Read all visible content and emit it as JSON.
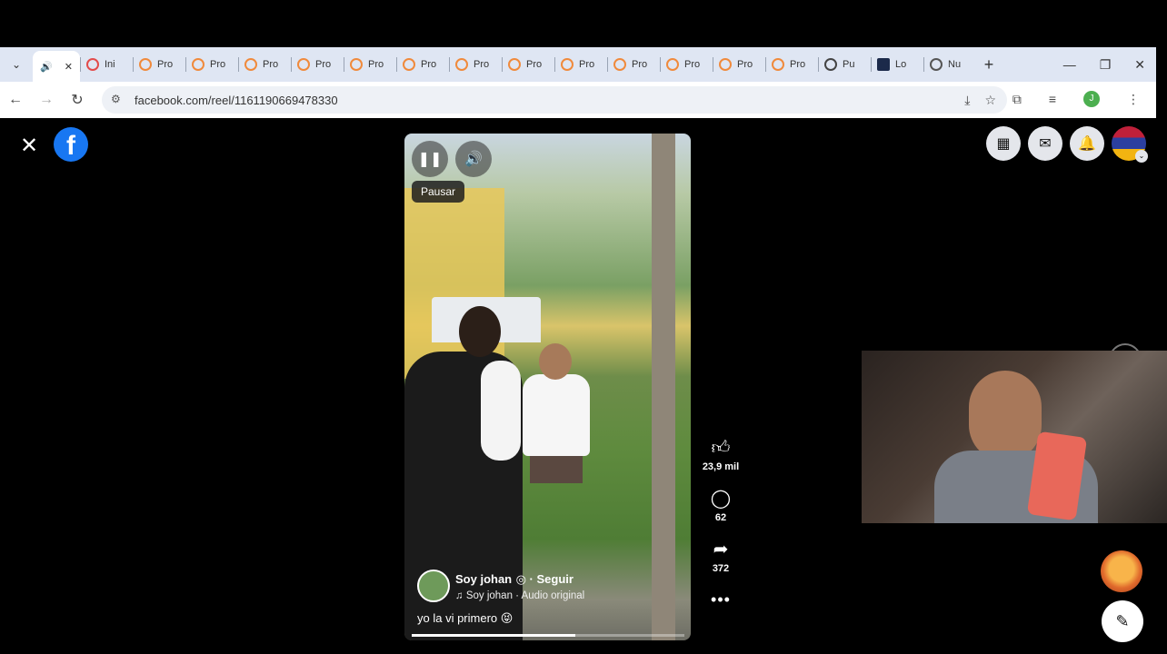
{
  "browser": {
    "tabs": [
      {
        "label": "Ini",
        "icon": "youtube-icon"
      },
      {
        "label": "Pro"
      },
      {
        "label": "Pro"
      },
      {
        "label": "Pro"
      },
      {
        "label": "Pro"
      },
      {
        "label": "Pro"
      },
      {
        "label": "Pro"
      },
      {
        "label": "Pro"
      },
      {
        "label": "Pro"
      },
      {
        "label": "Pro"
      },
      {
        "label": "Pro"
      },
      {
        "label": "Pro"
      },
      {
        "label": "Pro"
      },
      {
        "label": "Pro"
      },
      {
        "label": "Pu",
        "icon": "github-icon"
      },
      {
        "label": "Lo",
        "icon": "app-icon"
      },
      {
        "label": "Nu",
        "icon": "globe-icon"
      }
    ],
    "active_tab_icon": "speaker-icon",
    "url": "facebook.com/reel/1161190669478330",
    "profile_initial": "J"
  },
  "reel": {
    "tooltip": "Pausar",
    "author": "Soy johan",
    "follow": "· Seguir",
    "audio": "♫ Soy johan · Audio original",
    "caption": "yo la vi primero 😝",
    "progress_percent": 60,
    "likes": "23,9 mil",
    "comments": "62",
    "shares": "372"
  },
  "colors": {
    "facebook_blue": "#1877f2",
    "tab_strip": "#dfe6f3"
  }
}
